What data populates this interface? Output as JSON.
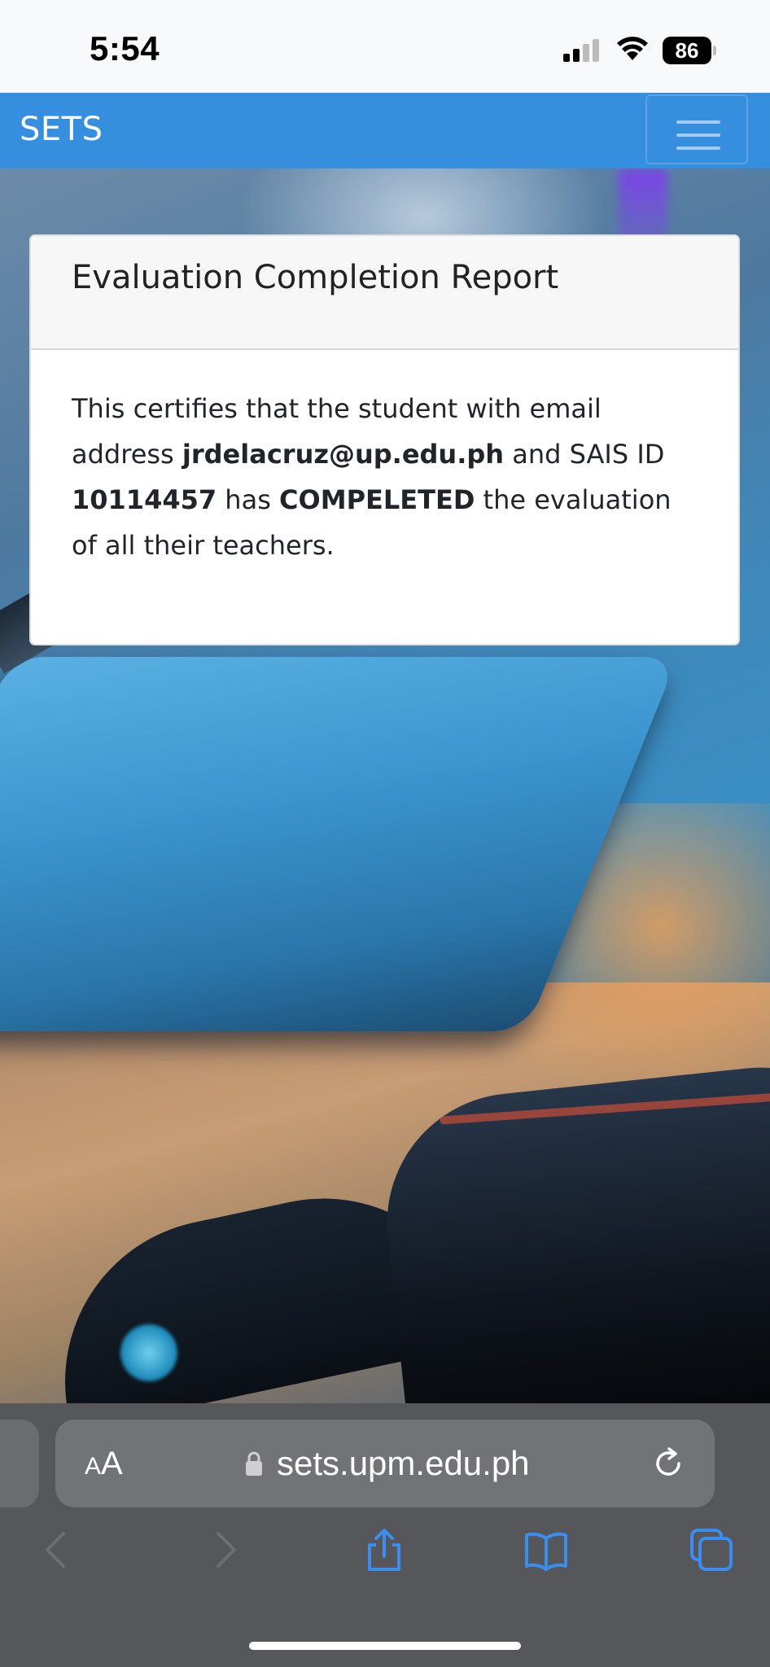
{
  "status_bar": {
    "time": "5:54",
    "battery_level": "86"
  },
  "navbar": {
    "brand": "SETS",
    "menu_icon": "hamburger-menu-icon"
  },
  "card": {
    "title": "Evaluation Completion Report",
    "body": {
      "text_1": "This certifies that the student with email address ",
      "email": "jrdelacruz@up.edu.ph",
      "text_2": " and SAIS ID ",
      "sais_id": "10114457",
      "text_3": " has ",
      "status": "COMPELETED",
      "text_4": " the evaluation of all their teachers."
    }
  },
  "browser": {
    "aa_small": "A",
    "aa_big": "A",
    "url": "sets.upm.edu.ph",
    "icons": {
      "lock": "lock-icon",
      "reload": "reload-icon",
      "back": "back-chevron-icon",
      "forward": "forward-chevron-icon",
      "share": "share-icon",
      "bookmarks": "bookmarks-book-icon",
      "tabs": "tabs-icon"
    }
  },
  "colors": {
    "navbar": "#368edf",
    "safari_toolbar": "#56575a",
    "toolbar_accent": "#3a8ef0"
  }
}
